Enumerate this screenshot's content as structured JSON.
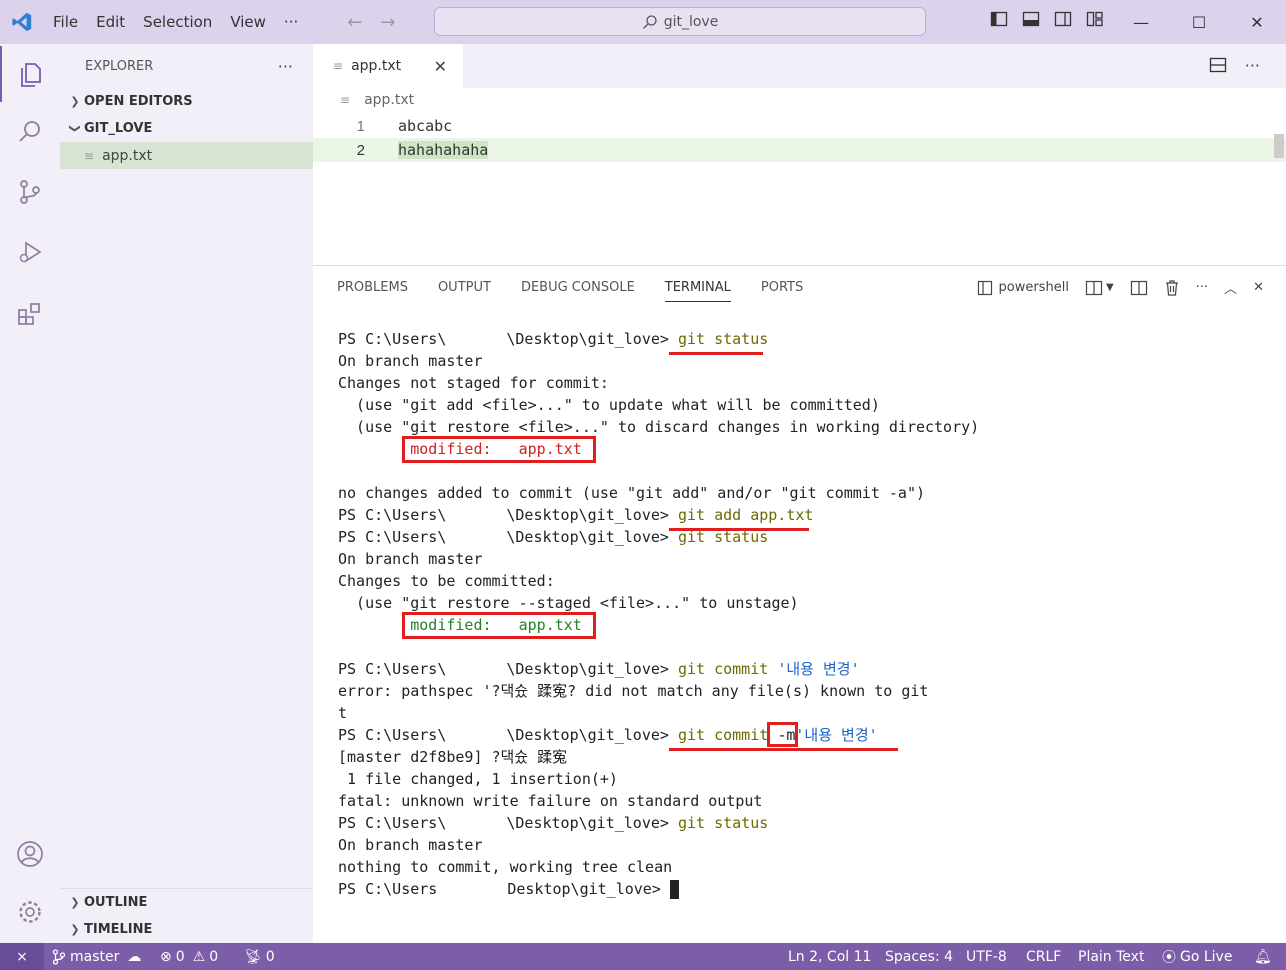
{
  "titlebar": {
    "menu": [
      "File",
      "Edit",
      "Selection",
      "View",
      "···"
    ],
    "search": "git_love"
  },
  "sidebar": {
    "title": "EXPLORER",
    "open_editors": "OPEN EDITORS",
    "folder": "GIT_LOVE",
    "file": "app.txt",
    "outline": "OUTLINE",
    "timeline": "TIMELINE"
  },
  "editor": {
    "tab_label": "app.txt",
    "breadcrumb": "app.txt",
    "lines": [
      {
        "num": "1",
        "text": "abcabc"
      },
      {
        "num": "2",
        "text": "hahahahaha"
      }
    ]
  },
  "panel": {
    "tabs": [
      "PROBLEMS",
      "OUTPUT",
      "DEBUG CONSOLE",
      "TERMINAL",
      "PORTS"
    ],
    "shell": "powershell"
  },
  "terminal": {
    "prompt_a": "PS C:\\Users\\",
    "prompt_b": "\\Desktop\\git_love> ",
    "cmd1": "git status",
    "l2": "On branch master",
    "l3": "Changes not staged for commit:",
    "l4": "  (use \"git add <file>...\" to update what will be committed)",
    "l5": "  (use \"git restore <file>...\" to discard changes in working directory)",
    "mod1": "modified:   app.txt",
    "l7": "no changes added to commit (use \"git add\" and/or \"git commit -a\")",
    "cmd2": "git add app.txt",
    "cmd3": "git status",
    "l10": "On branch master",
    "l11": "Changes to be committed:",
    "l12": "  (use \"git restore --staged <file>...\" to unstage)",
    "mod2": "modified:   app.txt",
    "cmd4_a": "git commit ",
    "cmd4_b": "'내용 변경'",
    "l15": "error: pathspec '?댁슜 蹂寃? did not match any file(s) known to git",
    "l16": "t",
    "cmd5_a": "git commit ",
    "cmd5_flag": "-m",
    "cmd5_b": "'내용 변경'",
    "l18": "[master d2f8be9] ?댁슜 蹂寃",
    "l19": " 1 file changed, 1 insertion(+)",
    "l20": "fatal: unknown write failure on standard output",
    "cmd6": "git status",
    "l22": "On branch master",
    "l23": "nothing to commit, working tree clean",
    "last_prompt_a": "PS C:\\Users",
    "last_prompt_b": "Desktop\\git_love> "
  },
  "statusbar": {
    "branch": "master",
    "errors": "0",
    "warnings": "0",
    "ports": "0",
    "position": "Ln 2, Col 11",
    "spaces": "Spaces: 4",
    "encoding": "UTF-8",
    "eol": "CRLF",
    "language": "Plain Text",
    "golive": "Go Live"
  }
}
